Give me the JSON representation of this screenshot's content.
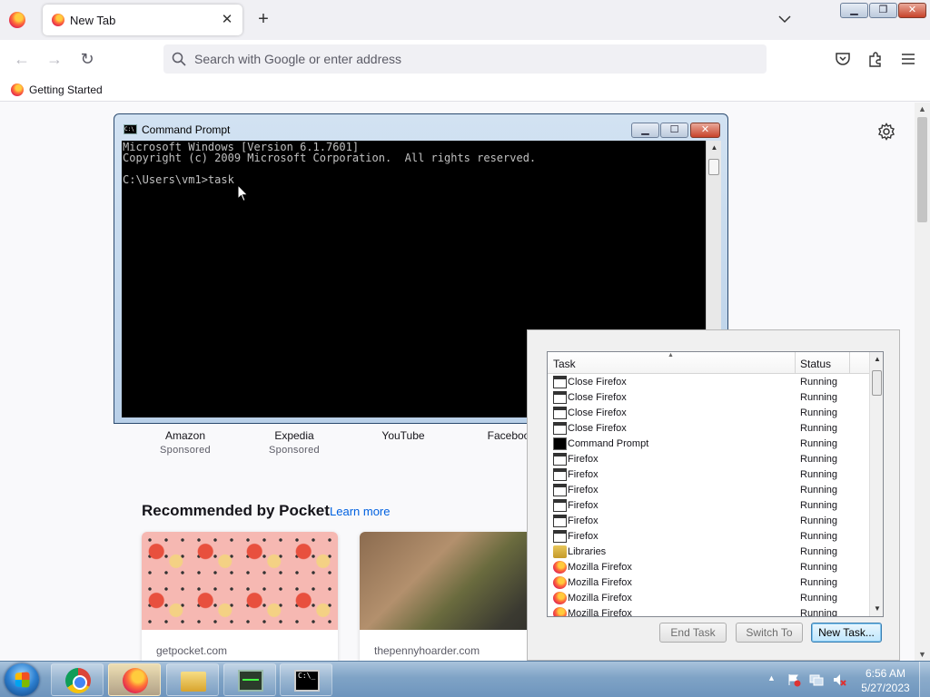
{
  "browser": {
    "tab": {
      "title": "New Tab"
    },
    "urlbar": {
      "placeholder": "Search with Google or enter address"
    },
    "bookmarks": [
      {
        "label": "Getting Started"
      }
    ]
  },
  "newtab": {
    "shortcuts": [
      {
        "name": "Amazon",
        "sponsored": "Sponsored"
      },
      {
        "name": "Expedia",
        "sponsored": "Sponsored"
      },
      {
        "name": "YouTube"
      },
      {
        "name": "Faceboo"
      }
    ],
    "pocket": {
      "title": "Recommended by Pocket",
      "learn_more": "Learn more",
      "cards": [
        {
          "source": "getpocket.com"
        },
        {
          "source": "thepennyhoarder.com"
        }
      ]
    }
  },
  "cmd": {
    "title": "Command Prompt",
    "lines": [
      "Microsoft Windows [Version 6.1.7601]",
      "Copyright (c) 2009 Microsoft Corporation.  All rights reserved.",
      "",
      "C:\\Users\\vm1>task"
    ]
  },
  "taskmgr": {
    "columns": {
      "task": "Task",
      "status": "Status"
    },
    "rows": [
      {
        "task": "Close Firefox",
        "status": "Running",
        "icon": "window-icon"
      },
      {
        "task": "Close Firefox",
        "status": "Running",
        "icon": "window-icon"
      },
      {
        "task": "Close Firefox",
        "status": "Running",
        "icon": "window-icon"
      },
      {
        "task": "Close Firefox",
        "status": "Running",
        "icon": "window-icon"
      },
      {
        "task": "Command Prompt",
        "status": "Running",
        "icon": "cmd-icon"
      },
      {
        "task": "Firefox",
        "status": "Running",
        "icon": "window-icon"
      },
      {
        "task": "Firefox",
        "status": "Running",
        "icon": "window-icon"
      },
      {
        "task": "Firefox",
        "status": "Running",
        "icon": "window-icon"
      },
      {
        "task": "Firefox",
        "status": "Running",
        "icon": "window-icon"
      },
      {
        "task": "Firefox",
        "status": "Running",
        "icon": "window-icon"
      },
      {
        "task": "Firefox",
        "status": "Running",
        "icon": "window-icon"
      },
      {
        "task": "Libraries",
        "status": "Running",
        "icon": "libraries-icon"
      },
      {
        "task": "Mozilla Firefox",
        "status": "Running",
        "icon": "firefox-icon"
      },
      {
        "task": "Mozilla Firefox",
        "status": "Running",
        "icon": "firefox-icon"
      },
      {
        "task": "Mozilla Firefox",
        "status": "Running",
        "icon": "firefox-icon"
      },
      {
        "task": "Mozilla Firefox",
        "status": "Running",
        "icon": "firefox-icon"
      }
    ],
    "buttons": {
      "end_task": "End Task",
      "switch_to": "Switch To",
      "new_task": "New Task..."
    }
  },
  "taskbar": {
    "apps": [
      "chrome-icon",
      "firefox-icon",
      "explorer-icon",
      "taskmgr-icon",
      "cmd-icon"
    ],
    "active_app": "firefox-icon",
    "clock": {
      "time": "6:56 AM",
      "date": "5/27/2023"
    }
  },
  "colors": {
    "link": "#0061e0",
    "cmd_text": "#c0c0c0",
    "taskbar": "#7fa3c6"
  }
}
